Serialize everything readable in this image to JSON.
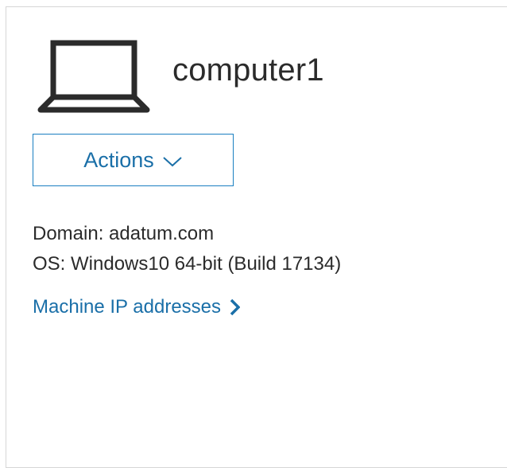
{
  "device": {
    "icon": "laptop-icon",
    "name": "computer1"
  },
  "actions": {
    "label": "Actions",
    "icon": "chevron-down-icon"
  },
  "details": {
    "domain": "Domain: adatum.com",
    "os": "OS: Windows10 64-bit (Build 17134)"
  },
  "link": {
    "label": "Machine IP addresses",
    "icon": "chevron-right-icon"
  },
  "colors": {
    "accent": "#1a7fc1",
    "text": "#2b2b2b",
    "border": "#d6d6d6"
  }
}
